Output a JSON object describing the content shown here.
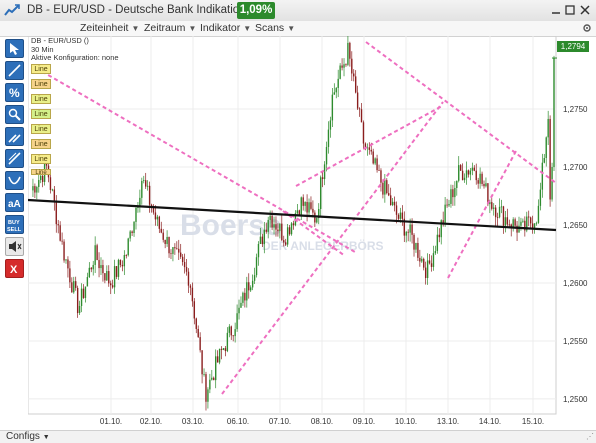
{
  "window": {
    "title": "DB - EUR/USD - Deutsche Bank Indikation",
    "change_badge": "1,09%",
    "icons": [
      "chart-app-icon",
      "minimize-icon",
      "restore-icon",
      "close-icon"
    ]
  },
  "menu": [
    {
      "label": "Zeiteinheit"
    },
    {
      "label": "Zeitraum"
    },
    {
      "label": "Indikator"
    },
    {
      "label": "Scans"
    }
  ],
  "toolbar": {
    "tools": [
      {
        "name": "select-cursor-icon"
      },
      {
        "name": "line-tool-icon"
      },
      {
        "name": "percent-tool-icon"
      },
      {
        "name": "pencil-tool-icon"
      },
      {
        "name": "zoom-tool-icon"
      },
      {
        "name": "measure-tool-icon"
      },
      {
        "name": "curve-tool-icon"
      },
      {
        "name": "text-tool-icon",
        "label": "aA"
      },
      {
        "name": "buy-sell-tool-icon",
        "label": "BUY SELL"
      },
      {
        "name": "sound-tool-icon"
      },
      {
        "name": "delete-tool-icon",
        "label": "X"
      }
    ]
  },
  "chart_info": {
    "symbol": "DB - EUR/USD ()",
    "interval": "30 Min",
    "configuration": "Aktive Konfiguration: none"
  },
  "drawing_tags": [
    "Line",
    "Line",
    "Line",
    "Line",
    "Line",
    "Line",
    "Line",
    "Line"
  ],
  "watermark": {
    "brand": "Boerse",
    "subtitle": "DER ANLEGERBÖRS"
  },
  "last_price_label": "1,2794",
  "bottom": {
    "configs_label": "Configs"
  },
  "colors": {
    "up_candle": "#2e8b2e",
    "down_candle": "#8b1e1e",
    "trendline_pink": "#ee6fc0",
    "support_black": "#111111",
    "badge_green": "#2c8a2c"
  },
  "chart_data": {
    "type": "candlestick",
    "instrument": "EUR/USD",
    "interval": "30 Min",
    "x_ticks": [
      "01.10.",
      "02.10.",
      "03.10.",
      "06.10.",
      "07.10.",
      "08.10.",
      "09.10.",
      "10.10.",
      "13.10.",
      "14.10.",
      "15.10."
    ],
    "y_ticks": [
      "1,2500",
      "1,2550",
      "1,2600",
      "1,2650",
      "1,2700",
      "1,2750"
    ],
    "y_range": [
      1.2487,
      1.2813
    ],
    "last_price": 1.2794,
    "key_points": [
      {
        "date": "29.09.",
        "price": 1.268
      },
      {
        "date": "30.09.",
        "price": 1.27
      },
      {
        "date": "01.10.",
        "price": 1.263
      },
      {
        "date": "01.10.",
        "price": 1.2578
      },
      {
        "date": "01.10.",
        "price": 1.2625
      },
      {
        "date": "02.10.",
        "price": 1.26
      },
      {
        "date": "02.10.",
        "price": 1.2625
      },
      {
        "date": "03.10.",
        "price": 1.269
      },
      {
        "date": "03.10.",
        "price": 1.265
      },
      {
        "date": "03.10.",
        "price": 1.2625
      },
      {
        "date": "03.10.",
        "price": 1.2605
      },
      {
        "date": "06.10.",
        "price": 1.2505
      },
      {
        "date": "06.10.",
        "price": 1.254
      },
      {
        "date": "06.10.",
        "price": 1.257
      },
      {
        "date": "07.10.",
        "price": 1.261
      },
      {
        "date": "07.10.",
        "price": 1.266
      },
      {
        "date": "08.10.",
        "price": 1.264
      },
      {
        "date": "08.10.",
        "price": 1.267
      },
      {
        "date": "08.10.",
        "price": 1.2655
      },
      {
        "date": "09.10.",
        "price": 1.276
      },
      {
        "date": "09.10.",
        "price": 1.28
      },
      {
        "date": "09.10.",
        "price": 1.272
      },
      {
        "date": "10.10.",
        "price": 1.269
      },
      {
        "date": "10.10.",
        "price": 1.266
      },
      {
        "date": "10.10.",
        "price": 1.264
      },
      {
        "date": "13.10.",
        "price": 1.261
      },
      {
        "date": "13.10.",
        "price": 1.2655
      },
      {
        "date": "13.10.",
        "price": 1.2695
      },
      {
        "date": "14.10.",
        "price": 1.27
      },
      {
        "date": "14.10.",
        "price": 1.267
      },
      {
        "date": "14.10.",
        "price": 1.2655
      },
      {
        "date": "15.10.",
        "price": 1.2645
      },
      {
        "date": "15.10.",
        "price": 1.266
      },
      {
        "date": "15.10.",
        "price": 1.2794
      }
    ],
    "trendlines": [
      {
        "type": "resistance",
        "color": "pink",
        "style": "dashed"
      },
      {
        "type": "resistance",
        "color": "pink",
        "style": "dashed"
      },
      {
        "type": "channel-support",
        "color": "pink",
        "style": "dashed"
      },
      {
        "type": "channel-resistance",
        "color": "pink",
        "style": "dashed"
      },
      {
        "type": "channel-support",
        "color": "pink",
        "style": "dashed"
      },
      {
        "type": "channel-resistance",
        "color": "pink",
        "style": "dashed"
      },
      {
        "type": "support",
        "color": "black",
        "style": "solid"
      }
    ],
    "grid": true
  }
}
